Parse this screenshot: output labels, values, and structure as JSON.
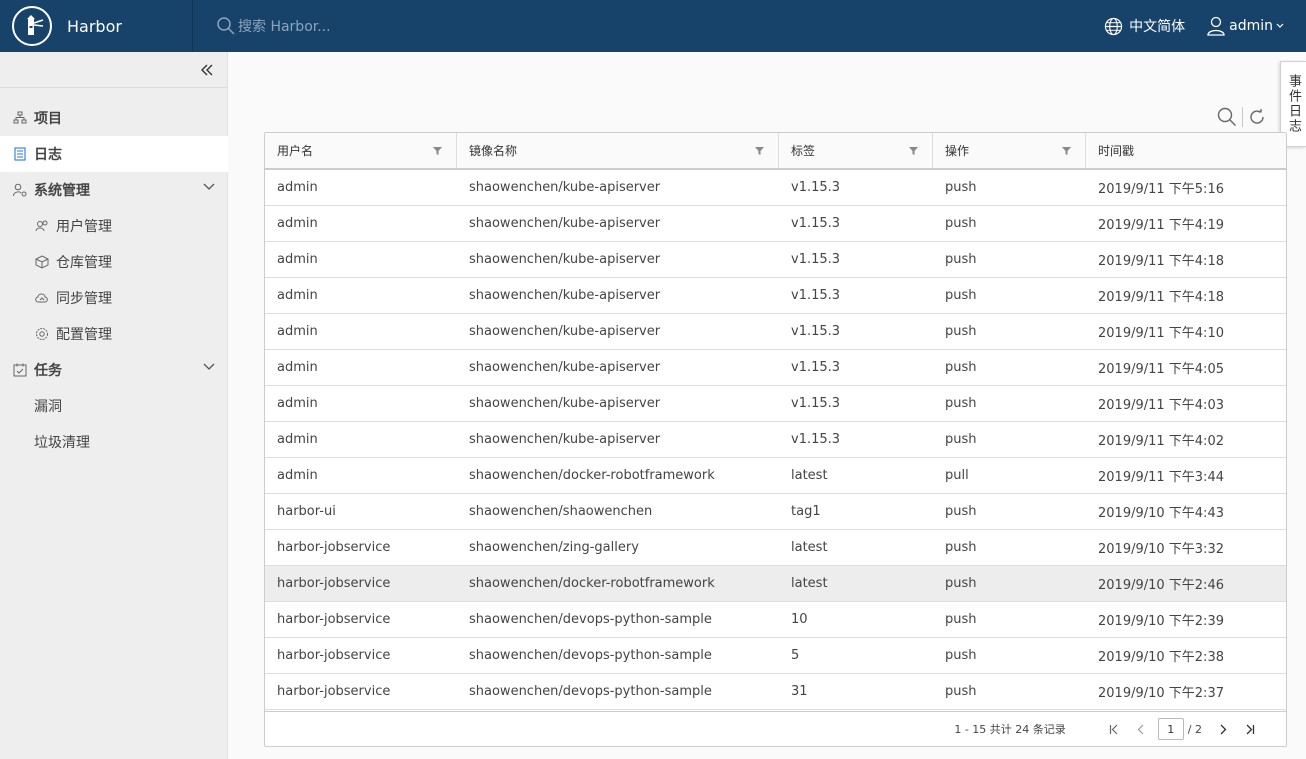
{
  "header": {
    "brand": "Harbor",
    "search_placeholder": "搜索 Harbor...",
    "language": "中文简体",
    "user": "admin"
  },
  "sidebar": {
    "items": [
      {
        "label": "项目",
        "icon": "project-icon"
      },
      {
        "label": "日志",
        "icon": "log-icon"
      },
      {
        "label": "系统管理",
        "icon": "admin-icon"
      },
      {
        "label": "用户管理",
        "icon": "users-icon"
      },
      {
        "label": "仓库管理",
        "icon": "registry-icon"
      },
      {
        "label": "同步管理",
        "icon": "replication-icon"
      },
      {
        "label": "配置管理",
        "icon": "config-icon"
      },
      {
        "label": "任务",
        "icon": "tasks-icon"
      },
      {
        "label": "漏洞"
      },
      {
        "label": "垃圾清理"
      }
    ]
  },
  "event_tab": "事件日志",
  "table": {
    "columns": [
      "用户名",
      "镜像名称",
      "标签",
      "操作",
      "时间戳"
    ],
    "rows": [
      [
        "admin",
        "shaowenchen/kube-apiserver",
        "v1.15.3",
        "push",
        "2019/9/11 下午5:16"
      ],
      [
        "admin",
        "shaowenchen/kube-apiserver",
        "v1.15.3",
        "push",
        "2019/9/11 下午4:19"
      ],
      [
        "admin",
        "shaowenchen/kube-apiserver",
        "v1.15.3",
        "push",
        "2019/9/11 下午4:18"
      ],
      [
        "admin",
        "shaowenchen/kube-apiserver",
        "v1.15.3",
        "push",
        "2019/9/11 下午4:18"
      ],
      [
        "admin",
        "shaowenchen/kube-apiserver",
        "v1.15.3",
        "push",
        "2019/9/11 下午4:10"
      ],
      [
        "admin",
        "shaowenchen/kube-apiserver",
        "v1.15.3",
        "push",
        "2019/9/11 下午4:05"
      ],
      [
        "admin",
        "shaowenchen/kube-apiserver",
        "v1.15.3",
        "push",
        "2019/9/11 下午4:03"
      ],
      [
        "admin",
        "shaowenchen/kube-apiserver",
        "v1.15.3",
        "push",
        "2019/9/11 下午4:02"
      ],
      [
        "admin",
        "shaowenchen/docker-robotframework",
        "latest",
        "pull",
        "2019/9/11 下午3:44"
      ],
      [
        "harbor-ui",
        "shaowenchen/shaowenchen",
        "tag1",
        "push",
        "2019/9/10 下午4:43"
      ],
      [
        "harbor-jobservice",
        "shaowenchen/zing-gallery",
        "latest",
        "push",
        "2019/9/10 下午3:32"
      ],
      [
        "harbor-jobservice",
        "shaowenchen/docker-robotframework",
        "latest",
        "push",
        "2019/9/10 下午2:46"
      ],
      [
        "harbor-jobservice",
        "shaowenchen/devops-python-sample",
        "10",
        "push",
        "2019/9/10 下午2:39"
      ],
      [
        "harbor-jobservice",
        "shaowenchen/devops-python-sample",
        "5",
        "push",
        "2019/9/10 下午2:38"
      ],
      [
        "harbor-jobservice",
        "shaowenchen/devops-python-sample",
        "31",
        "push",
        "2019/9/10 下午2:37"
      ]
    ]
  },
  "pagination": {
    "summary": "1 - 15 共计 24 条记录",
    "current_page": "1",
    "total_pages": "/ 2"
  }
}
